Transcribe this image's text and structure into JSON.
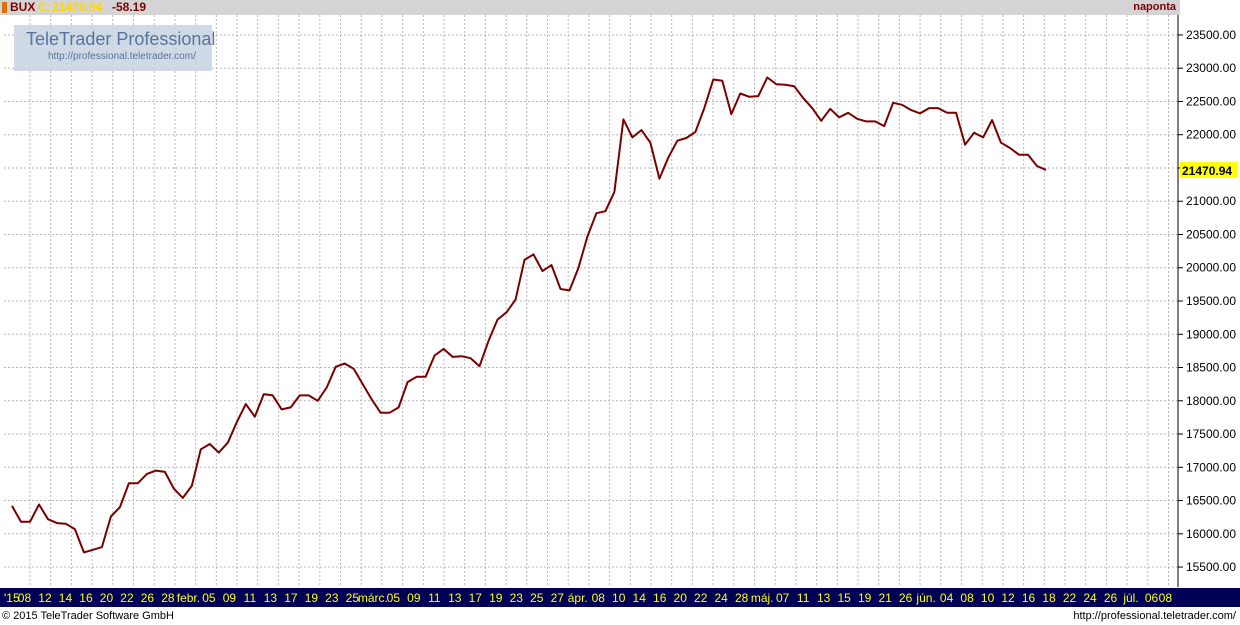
{
  "header": {
    "symbol": "BUX",
    "close_label": "C:",
    "close_value": "21470.94",
    "change": "-58.19",
    "period": "naponta"
  },
  "logo": {
    "title": "TeleTrader Professional",
    "url": "http://professional.teletrader.com/"
  },
  "footer": {
    "copyright": "© 2015 TeleTrader Software GmbH",
    "url": "http://professional.teletrader.com/"
  },
  "colors": {
    "line": "#7a0000",
    "axis_bar": "#000055",
    "axis_text": "#ffff00",
    "last_value_box": "#ffff00"
  },
  "chart_data": {
    "type": "line",
    "title": "",
    "xlabel": "",
    "ylabel": "",
    "ylim": [
      15200,
      23800
    ],
    "y_ticks": [
      15500,
      16000,
      16500,
      17000,
      17500,
      18000,
      18500,
      19000,
      19500,
      20000,
      20500,
      21000,
      21500,
      22000,
      22500,
      23000,
      23500
    ],
    "y_tick_labels": [
      "15500.00",
      "16000.00",
      "16500.00",
      "17000.00",
      "17500.00",
      "18000.00",
      "18500.00",
      "19000.00",
      "19500.00",
      "20000.00",
      "20500.00",
      "21000.00",
      "21500.00",
      "22000.00",
      "22500.00",
      "23000.00",
      "23500.00"
    ],
    "last_value": 21470.94,
    "last_value_label": "21470.94",
    "grid": true,
    "x_tick_labels": [
      "'15",
      "08",
      "12",
      "14",
      "16",
      "20",
      "22",
      "26",
      "28",
      "febr.",
      "05",
      "09",
      "11",
      "13",
      "17",
      "19",
      "23",
      "25",
      "márc.",
      "05",
      "09",
      "11",
      "13",
      "17",
      "19",
      "23",
      "25",
      "27",
      "ápr.",
      "08",
      "10",
      "14",
      "16",
      "20",
      "22",
      "24",
      "28",
      "máj.",
      "07",
      "11",
      "13",
      "15",
      "19",
      "21",
      "26",
      "jún.",
      "04",
      "08",
      "10",
      "12",
      "16",
      "18",
      "22",
      "24",
      "26",
      "júl.",
      "06",
      "08"
    ],
    "series": [
      {
        "values": [
          16420,
          16180,
          16180,
          16440,
          16220,
          16160,
          16150,
          16070,
          15720,
          15760,
          15800,
          16260,
          16400,
          16760,
          16760,
          16900,
          16950,
          16930,
          16680,
          16540,
          16720,
          17270,
          17350,
          17220,
          17370,
          17680,
          17950,
          17760,
          18100,
          18080,
          17870,
          17900,
          18080,
          18080,
          18000,
          18200,
          18510,
          18560,
          18480,
          18250,
          18020,
          17820,
          17820,
          17900,
          18280,
          18360,
          18360,
          18680,
          18780,
          18660,
          18670,
          18640,
          18520,
          18900,
          19220,
          19330,
          19520,
          20120,
          20200,
          19950,
          20040,
          19680,
          19660,
          20000,
          20470,
          20820,
          20850,
          21140,
          22230,
          21960,
          22070,
          21880,
          21340,
          21660,
          21910,
          21950,
          22040,
          22400,
          22830,
          22810,
          22310,
          22620,
          22570,
          22580,
          22860,
          22760,
          22750,
          22730,
          22550,
          22400,
          22210,
          22390,
          22260,
          22330,
          22240,
          22200,
          22200,
          22130,
          22480,
          22450,
          22370,
          22320,
          22400,
          22400,
          22330,
          22330,
          21850,
          22030,
          21960,
          22220,
          21880,
          21800,
          21700,
          21700,
          21530,
          21470.94
        ]
      }
    ]
  }
}
